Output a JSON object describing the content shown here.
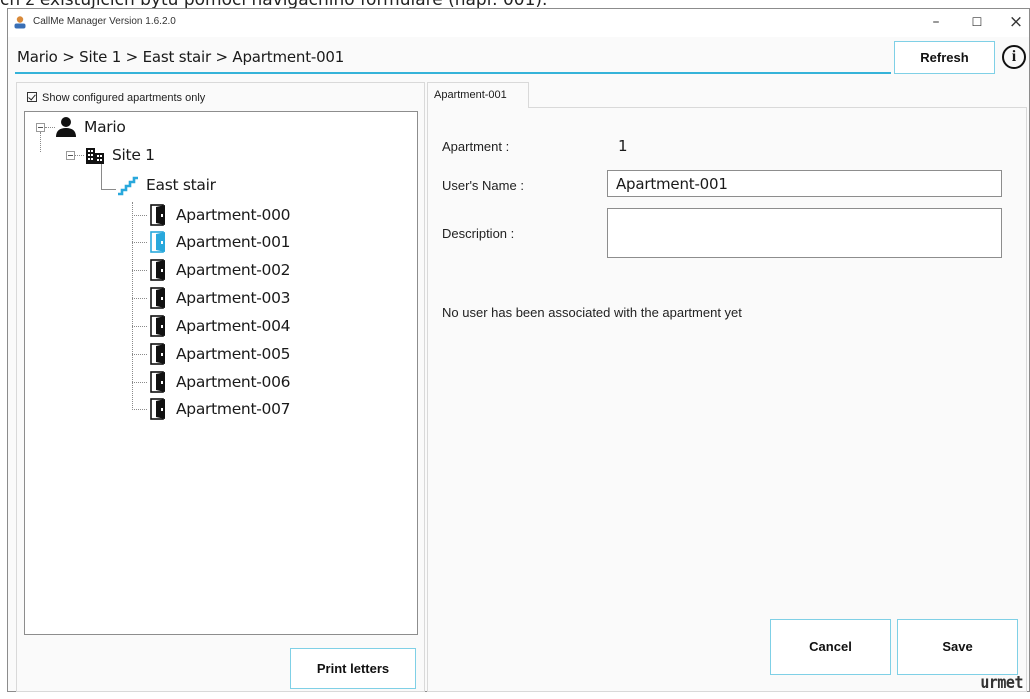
{
  "caption_partial": "ch z existujících bytů pomocí navigačního formuláře (např. 001).",
  "window": {
    "title": "CallMe Manager Version 1.6.2.0",
    "controls": {
      "minimize": "–",
      "maximize": "☐",
      "close": "×"
    }
  },
  "breadcrumb": "Mario > Site 1 > East stair > Apartment-001",
  "toolbar": {
    "refresh_label": "Refresh",
    "info_label": "i"
  },
  "left": {
    "show_configured_label": "Show configured apartments only",
    "show_configured_checked": true,
    "tree": {
      "root": "Mario",
      "site": "Site 1",
      "stair": "East stair",
      "apartments": [
        "Apartment-000",
        "Apartment-001",
        "Apartment-002",
        "Apartment-003",
        "Apartment-004",
        "Apartment-005",
        "Apartment-006",
        "Apartment-007"
      ],
      "selected": "Apartment-001"
    },
    "print_letters_label": "Print letters"
  },
  "right": {
    "tab_label": "Apartment-001",
    "apartment_label": "Apartment :",
    "apartment_value": "1",
    "users_name_label": "User's Name :",
    "users_name_value": "Apartment-001",
    "description_label": "Description :",
    "description_value": "",
    "no_user_message": "No user has been associated with the apartment yet",
    "cancel_label": "Cancel",
    "save_label": "Save"
  },
  "brand": "urmet",
  "colors": {
    "accent": "#35b3d9",
    "button_border": "#7fd0e6",
    "selected_icon": "#29a8dc"
  }
}
